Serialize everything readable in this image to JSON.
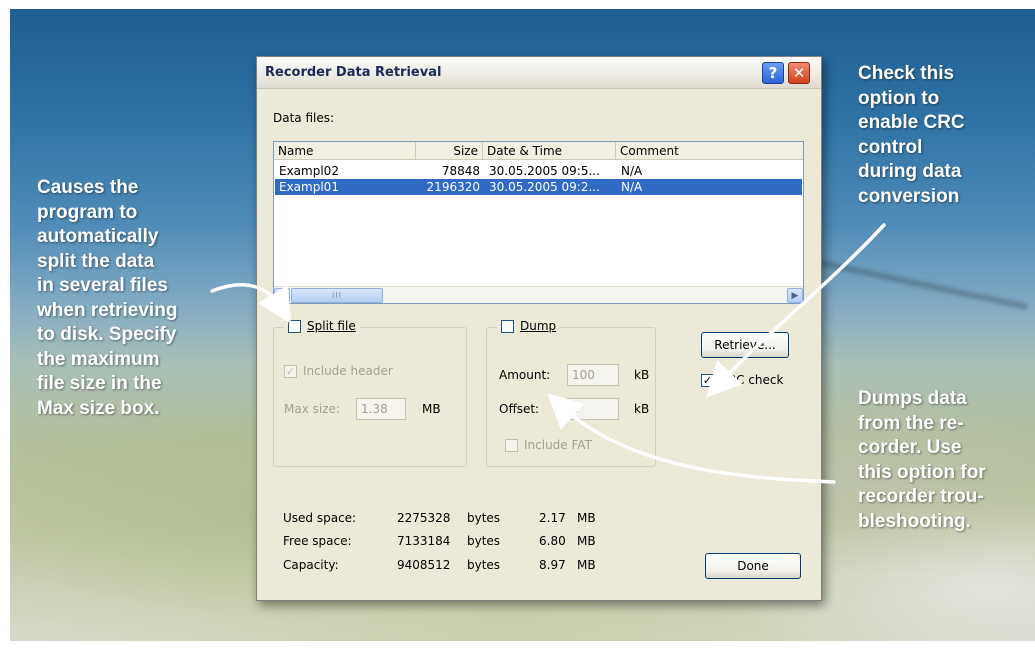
{
  "dialog": {
    "title": "Recorder Data Retrieval",
    "help_glyph": "?",
    "close_glyph": "✕",
    "data_files_label": "Data files:",
    "columns": [
      "Name",
      "Size",
      "Date & Time",
      "Comment"
    ],
    "rows": [
      {
        "name": "Exampl02",
        "size": "78848",
        "datetime": "30.05.2005 09:5...",
        "comment": "N/A",
        "selected": false
      },
      {
        "name": "Exampl01",
        "size": "2196320",
        "datetime": "30.05.2005 09:2...",
        "comment": "N/A",
        "selected": true
      }
    ],
    "scroll_left_glyph": "◀",
    "scroll_right_glyph": "▶",
    "scroll_thumb_grip": "III",
    "split_file": {
      "label": "Split file",
      "checked": false,
      "include_header_label": "Include header",
      "include_header_checked": true,
      "max_size_label": "Max size:",
      "max_size_value": "1.38",
      "max_size_unit": "MB"
    },
    "dump": {
      "label": "Dump",
      "checked": false,
      "amount_label": "Amount:",
      "amount_value": "100",
      "amount_unit": "kB",
      "offset_label": "Offset:",
      "offset_value": "0",
      "offset_unit": "kB",
      "include_fat_label": "Include FAT",
      "include_fat_checked": false
    },
    "retrieve_label": "Retrieve...",
    "crc_check_label": "CRC check",
    "crc_check_checked": true,
    "check_glyph": "✓",
    "stats": [
      {
        "label": "Used space:",
        "bytes": "2275328",
        "bytes_unit": "bytes",
        "mb": "2.17",
        "mb_unit": "MB"
      },
      {
        "label": "Free space:",
        "bytes": "7133184",
        "bytes_unit": "bytes",
        "mb": "6.80",
        "mb_unit": "MB"
      },
      {
        "label": "Capacity:",
        "bytes": "9408512",
        "bytes_unit": "bytes",
        "mb": "8.97",
        "mb_unit": "MB"
      }
    ],
    "done_label": "Done"
  },
  "annotations": {
    "left": "Causes the\nprogram to\nautomatically\nsplit the data\nin several files\nwhen retrieving\nto disk. Specify\nthe maximum\nfile size in the\nMax size box.",
    "right_top": "Check this\noption to\nenable CRC\ncontrol\nduring data\nconversion",
    "right_bottom": "Dumps data\nfrom the re-\ncorder. Use\nthis option for\nrecorder trou-\nbleshooting."
  },
  "colors": {
    "selection": "#316ac5",
    "dialog_bg": "#ece9d8",
    "annotation_text": "#ffffff",
    "arrow": "#ffffff"
  }
}
